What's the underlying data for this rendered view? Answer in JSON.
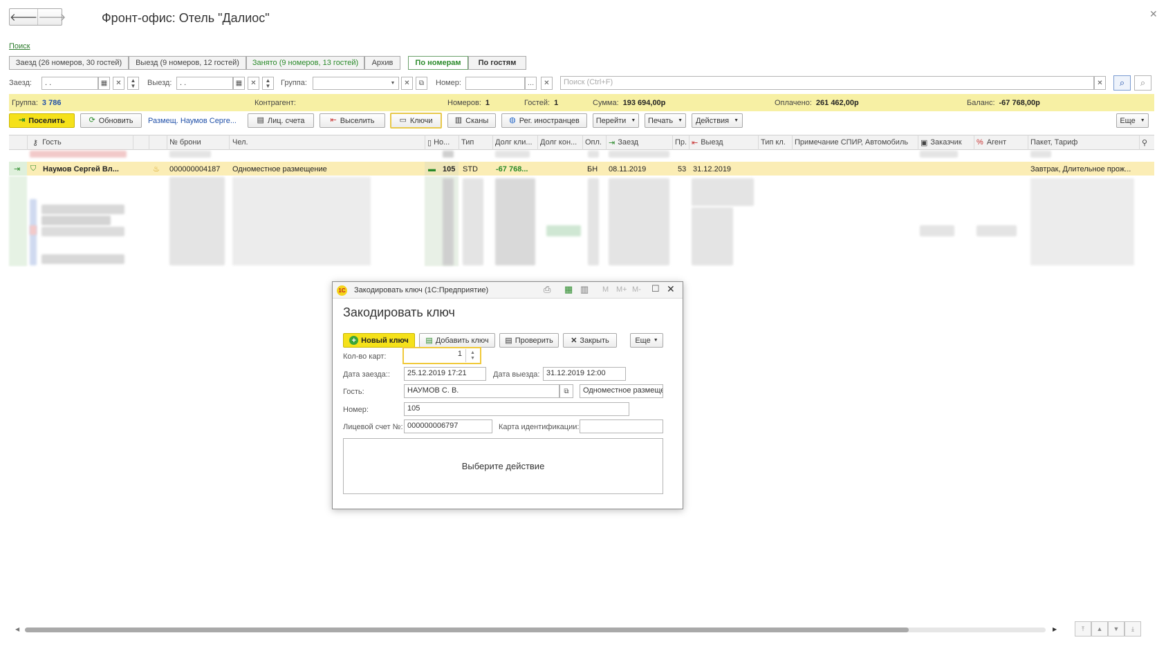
{
  "window": {
    "title": "Фронт-офис: Отель \"Далиос\""
  },
  "search_link": "Поиск",
  "tabs": [
    {
      "label": "Заезд (26 номеров, 30 гостей)"
    },
    {
      "label": "Выезд (9 номеров, 12 гостей)"
    },
    {
      "label": "Занято (9 номеров, 13 гостей)"
    },
    {
      "label": "Архив"
    }
  ],
  "view_toggle": {
    "by_rooms": "По номерам",
    "by_guests": "По гостям"
  },
  "filters": {
    "arrival_label": "Заезд:",
    "arrival_value": " .  . ",
    "departure_label": "Выезд:",
    "departure_value": " .  . ",
    "group_label": "Группа:",
    "room_label": "Номер:",
    "search_placeholder": "Поиск (Ctrl+F)"
  },
  "summary": {
    "group_label": "Группа:",
    "group_value": "3 786",
    "contractor_label": "Контрагент:",
    "rooms_label": "Номеров:",
    "rooms_value": "1",
    "guests_label": "Гостей:",
    "guests_value": "1",
    "sum_label": "Сумма:",
    "sum_value": "193 694,00р",
    "paid_label": "Оплачено:",
    "paid_value": "261 462,00р",
    "balance_label": "Баланс:",
    "balance_value": "-67 768,00р"
  },
  "toolbar": {
    "checkin": "Поселить",
    "refresh": "Обновить",
    "placement_link": "Размещ. Наумов Серге...",
    "accounts": "Лиц. счета",
    "checkout": "Выселить",
    "keys": "Ключи",
    "scans": "Сканы",
    "foreigners": "Рег. иностранцев",
    "goto": "Перейти",
    "print": "Печать",
    "actions": "Действия",
    "more": "Еще"
  },
  "table": {
    "columns": [
      "Гость",
      "№ брони",
      "Чел.",
      "Но...",
      "Тип",
      "Долг кли...",
      "Долг кон...",
      "Опл.",
      "Заезд",
      "Пр.",
      "Выезд",
      "Тип кл.",
      "Примечание СПИР, Автомобиль",
      "Заказчик",
      "Агент",
      "Пакет, Тариф"
    ],
    "row": {
      "guest": "Наумов Сергей Вл...",
      "booking": "000000004187",
      "people": "Одноместное размещение",
      "room": "105",
      "type": "STD",
      "client_debt": "-67 768...",
      "payment": "БН",
      "arrival": "08.11.2019",
      "nights": "53",
      "departure": "31.12.2019",
      "package": "Завтрак, Длительное прож..."
    }
  },
  "dialog": {
    "titlebar": "Закодировать ключ  (1С:Предприятие)",
    "heading": "Закодировать ключ",
    "buttons": {
      "new_key": "Новый ключ",
      "add_key": "Добавить ключ",
      "check": "Проверить",
      "close": "Закрыть",
      "more": "Еще"
    },
    "tb_m": "M",
    "tb_mplus": "M+",
    "tb_mminus": "M-",
    "cards_label": "Кол-во карт:",
    "cards_value": "1",
    "arrival_label": "Дата заезда::",
    "arrival_value": "25.12.2019 17:21",
    "departure_label": "Дата выезда:",
    "departure_value": "31.12.2019 12:00",
    "guest_label": "Гость:",
    "guest_value": "НАУМОВ С. В.",
    "placement_value": "Одноместное размеще",
    "room_label": "Номер:",
    "room_value": "105",
    "account_label": "Лицевой счет №:",
    "account_value": "000000006797",
    "idcard_label": "Карта идентификации:",
    "idcard_value": "",
    "message": "Выберите действие"
  },
  "colors": {
    "summary_bg": "#f7f0a4",
    "highlight_row": "#fbedb5",
    "primary_button": "#f5e11a",
    "link": "#1f4fa8",
    "positive": "#2a8a2a"
  }
}
